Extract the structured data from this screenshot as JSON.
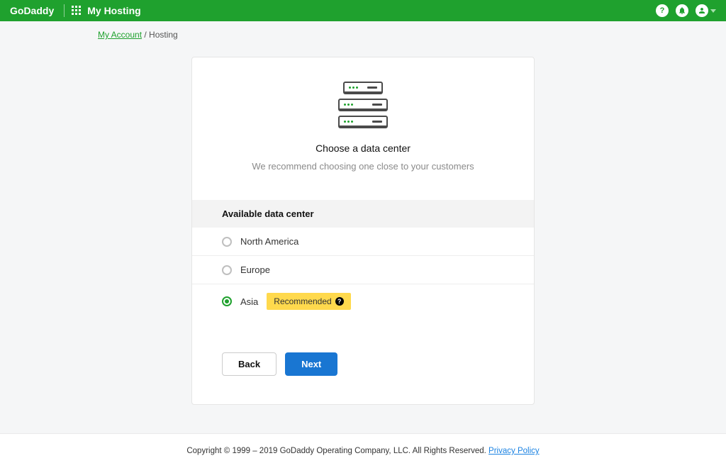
{
  "header": {
    "logo": "GoDaddy",
    "product_title": "My Hosting"
  },
  "breadcrumb": {
    "link_label": "My Account",
    "current": " / Hosting"
  },
  "card": {
    "title": "Choose a data center",
    "subtitle": "We recommend choosing one close to your customers",
    "section_header": "Available data center",
    "options": {
      "na": "North America",
      "eu": "Europe",
      "asia": "Asia"
    },
    "recommended_badge": "Recommended",
    "back_label": "Back",
    "next_label": "Next"
  },
  "footer": {
    "copyright": "Copyright © 1999 – 2019 GoDaddy Operating Company, LLC. All Rights Reserved. ",
    "privacy_label": "Privacy Policy"
  }
}
